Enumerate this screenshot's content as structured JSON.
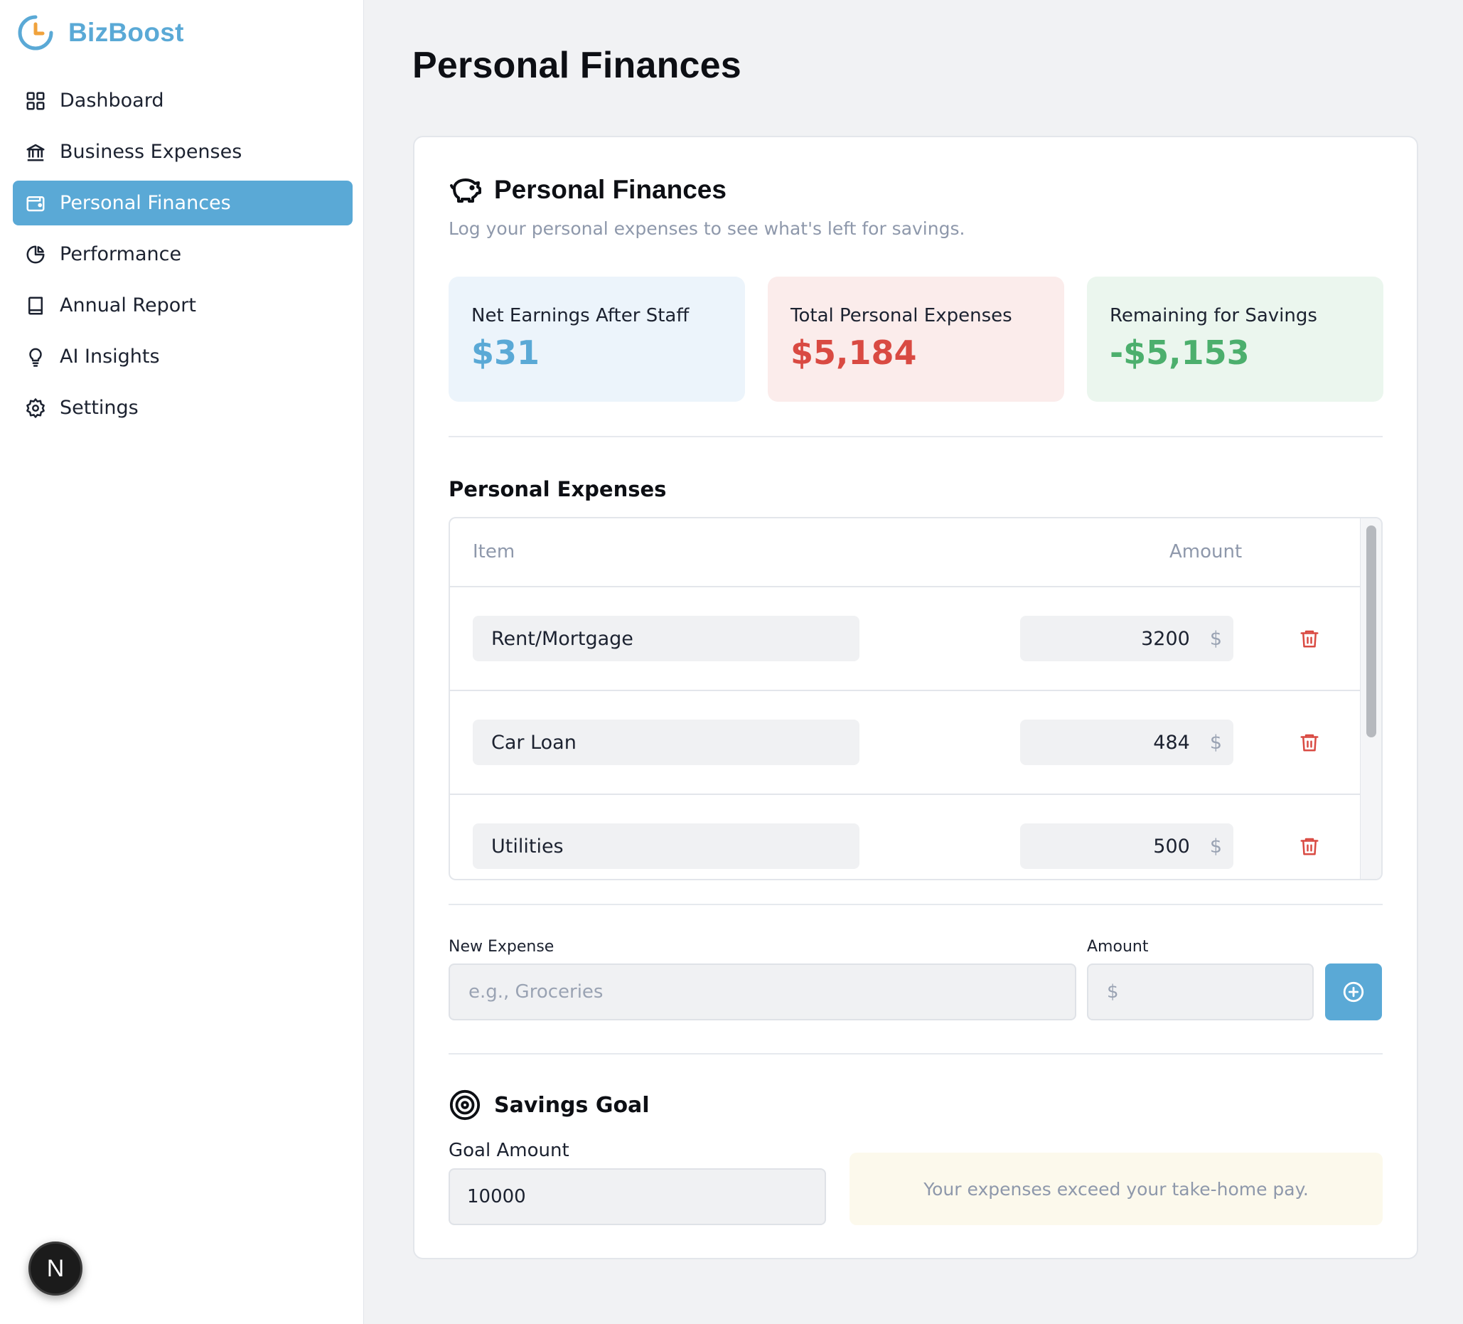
{
  "app": {
    "name": "BizBoost"
  },
  "sidebar": {
    "items": [
      {
        "label": "Dashboard",
        "icon": "grid-icon"
      },
      {
        "label": "Business Expenses",
        "icon": "bank-icon"
      },
      {
        "label": "Personal Finances",
        "icon": "wallet-icon",
        "active": true
      },
      {
        "label": "Performance",
        "icon": "pie-chart-icon"
      },
      {
        "label": "Annual Report",
        "icon": "book-icon"
      },
      {
        "label": "AI Insights",
        "icon": "lightbulb-icon"
      },
      {
        "label": "Settings",
        "icon": "gear-icon"
      }
    ],
    "badge": "N"
  },
  "page": {
    "title": "Personal Finances"
  },
  "card": {
    "title": "Personal Finances",
    "subtitle": "Log your personal expenses to see what's left for savings.",
    "icon": "piggy-bank-icon"
  },
  "stats": [
    {
      "label": "Net Earnings After Staff",
      "value": "$31",
      "color": "#5aa9d6"
    },
    {
      "label": "Total Personal Expenses",
      "value": "$5,184",
      "color": "#d94a42"
    },
    {
      "label": "Remaining for Savings",
      "value": "-$5,153",
      "color": "#4caf6d"
    }
  ],
  "expenses": {
    "title": "Personal Expenses",
    "columns": {
      "item": "Item",
      "amount": "Amount"
    },
    "currency": "$",
    "rows": [
      {
        "item": "Rent/Mortgage",
        "amount": "3200"
      },
      {
        "item": "Car Loan",
        "amount": "484"
      },
      {
        "item": "Utilities",
        "amount": "500"
      }
    ]
  },
  "new_expense": {
    "name_label": "New Expense",
    "name_placeholder": "e.g., Groceries",
    "amount_label": "Amount",
    "amount_placeholder": "$"
  },
  "savings_goal": {
    "title": "Savings Goal",
    "goal_label": "Goal Amount",
    "goal_value": "10000",
    "message": "Your expenses exceed your take-home pay."
  },
  "colors": {
    "accent": "#5aa9d6",
    "danger": "#d94a42",
    "success": "#4caf6d"
  }
}
